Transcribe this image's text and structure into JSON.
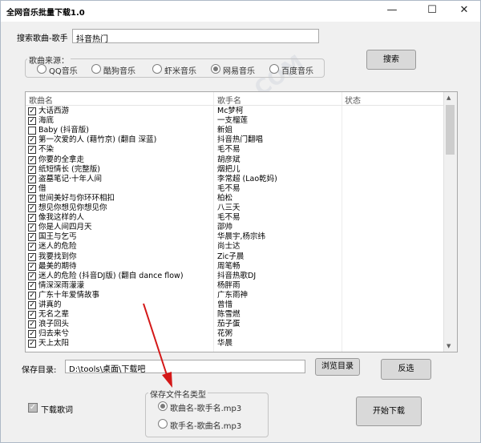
{
  "window": {
    "title": "全网音乐批量下载1.0",
    "minimize_icon": "minimize-icon",
    "maximize_icon": "maximize-icon",
    "close_icon": "close-icon"
  },
  "search": {
    "label": "搜索歌曲-歌手",
    "value": "抖音热门",
    "button": "搜索"
  },
  "source": {
    "legend": "歌曲来源：",
    "options": [
      "QQ音乐",
      "酷狗音乐",
      "虾米音乐",
      "网易音乐",
      "百度音乐"
    ],
    "selected": "网易音乐"
  },
  "list": {
    "columns": [
      "歌曲名",
      "歌手名",
      "状态"
    ],
    "rows": [
      {
        "checked": true,
        "song": "大话西游",
        "artist": "Mc梦柯"
      },
      {
        "checked": true,
        "song": "海底",
        "artist": "一支榴莲"
      },
      {
        "checked": false,
        "song": "Baby (抖音版)",
        "artist": "新姐"
      },
      {
        "checked": true,
        "song": "第一次爱的人 (藉竹京) (翻自 深蓝)",
        "artist": "抖音热门翻唱"
      },
      {
        "checked": true,
        "song": "不染",
        "artist": "毛不易"
      },
      {
        "checked": true,
        "song": "你要的全拿走",
        "artist": "胡彦斌"
      },
      {
        "checked": true,
        "song": "纸短情长 (完整版)",
        "artist": "烟把儿"
      },
      {
        "checked": true,
        "song": "盗墓笔记·十年人间",
        "artist": "李常超 (Lao乾妈)"
      },
      {
        "checked": true,
        "song": "借",
        "artist": "毛不易"
      },
      {
        "checked": true,
        "song": "世间美好与你环环相扣",
        "artist": "柏松"
      },
      {
        "checked": true,
        "song": "想见你想见你想见你",
        "artist": "八三夭"
      },
      {
        "checked": true,
        "song": "像我这样的人",
        "artist": "毛不易"
      },
      {
        "checked": true,
        "song": "你是人间四月天",
        "artist": "邵帅"
      },
      {
        "checked": true,
        "song": "国王与乞丐",
        "artist": "华晨宇,杨宗纬"
      },
      {
        "checked": true,
        "song": "迷人的危险",
        "artist": "尚士达"
      },
      {
        "checked": true,
        "song": "我要找到你",
        "artist": "Zic子晨"
      },
      {
        "checked": true,
        "song": "最美的期待",
        "artist": "周笔畅"
      },
      {
        "checked": true,
        "song": "迷人的危险 (抖音DJ版) (翻自 dance flow)",
        "artist": "抖音热歌DJ"
      },
      {
        "checked": true,
        "song": "情深深雨濛濛",
        "artist": "杨胖雨"
      },
      {
        "checked": true,
        "song": "广东十年爱情故事",
        "artist": "广东雨神"
      },
      {
        "checked": true,
        "song": "讲真的",
        "artist": "曾惜"
      },
      {
        "checked": true,
        "song": "无名之辈",
        "artist": "陈雪燃"
      },
      {
        "checked": true,
        "song": "浪子回头",
        "artist": "茄子蛋"
      },
      {
        "checked": true,
        "song": "归去来兮",
        "artist": "花粥"
      },
      {
        "checked": true,
        "song": "天上太阳",
        "artist": "华晨"
      }
    ]
  },
  "save": {
    "label": "保存目录:",
    "path": "D:\\tools\\桌面\\下载吧",
    "browse_button": "浏览目录",
    "invert_button": "反选"
  },
  "lyrics": {
    "label": "下载歌词",
    "checked": true
  },
  "filename": {
    "legend": "保存文件名类型",
    "options": [
      "歌曲名-歌手名.mp3",
      "歌手名-歌曲名.mp3"
    ],
    "selected": "歌曲名-歌手名.mp3"
  },
  "start_button": "开始下载"
}
